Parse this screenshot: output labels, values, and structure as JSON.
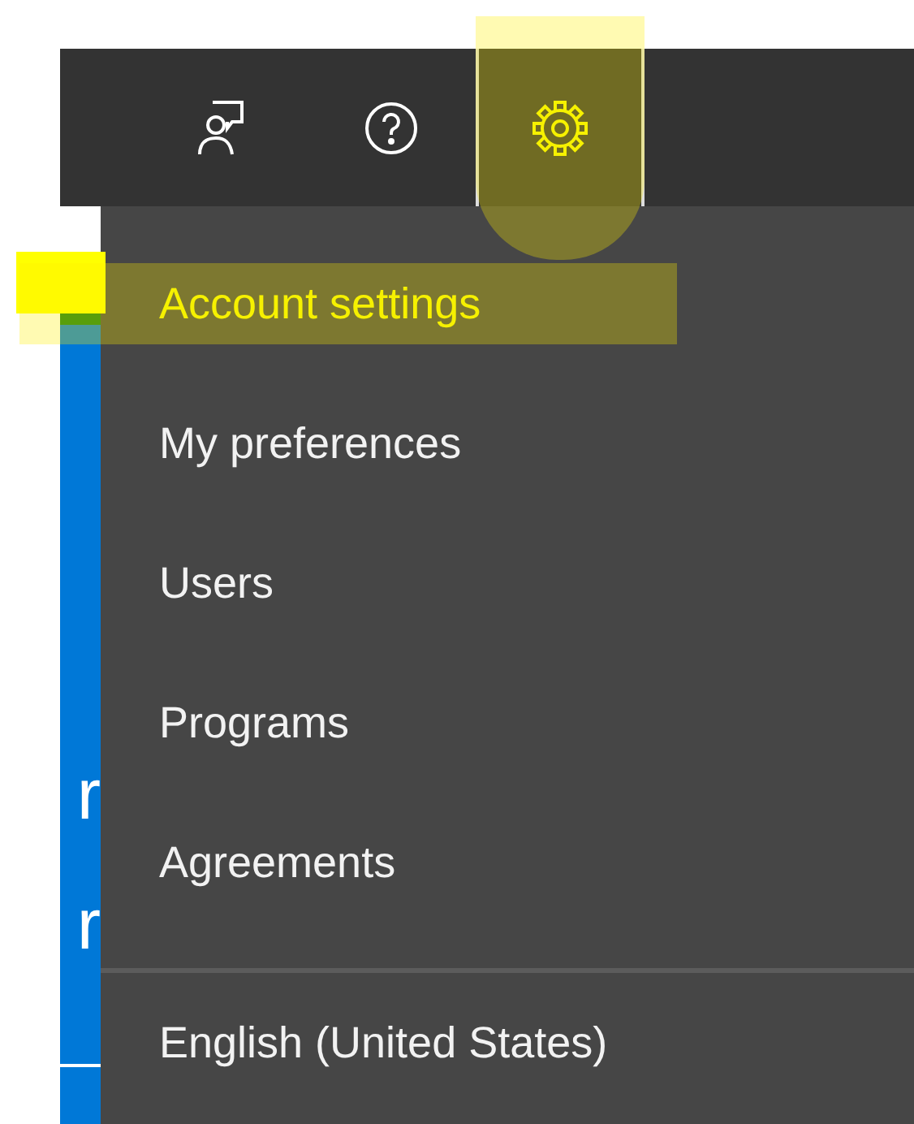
{
  "toolbar": {
    "buttons": [
      {
        "kind": "feedback",
        "highlighted": false
      },
      {
        "kind": "help",
        "highlighted": false
      },
      {
        "kind": "settings",
        "highlighted": true
      }
    ]
  },
  "side_panel": {
    "texts": [
      "r",
      "r"
    ]
  },
  "settings_menu": {
    "items": [
      {
        "label": "Account settings",
        "highlighted": true
      },
      {
        "label": "My preferences",
        "highlighted": false
      },
      {
        "label": "Users",
        "highlighted": false
      },
      {
        "label": "Programs",
        "highlighted": false
      },
      {
        "label": "Agreements",
        "highlighted": false
      }
    ],
    "footer_items": [
      {
        "label": "English (United States)",
        "highlighted": false
      }
    ]
  }
}
